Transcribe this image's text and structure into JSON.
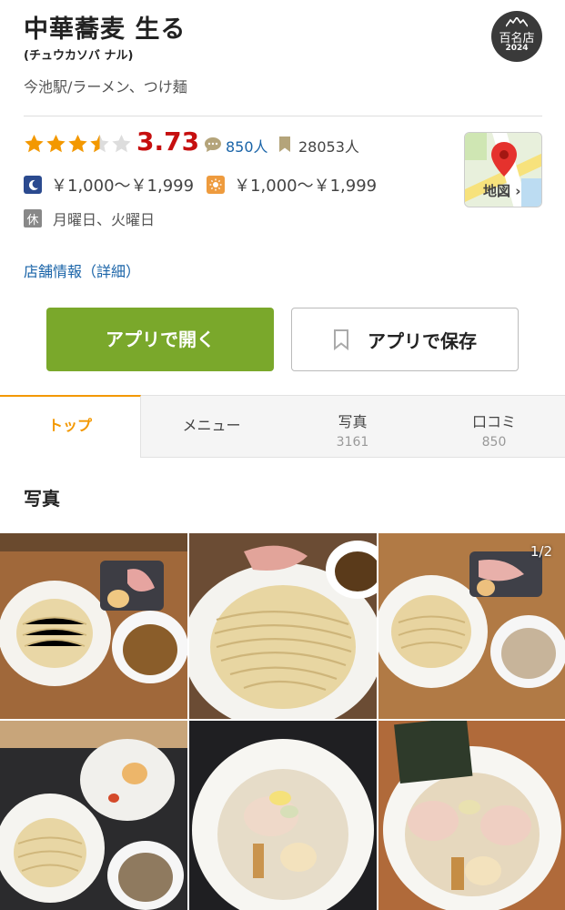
{
  "shop": {
    "name": "中華蕎麦 生る",
    "kana": "(チュウカソバ ナル)",
    "genre": "今池駅/ラーメン、つけ麺"
  },
  "badge": {
    "label": "百名店",
    "year": "2024"
  },
  "rating": {
    "stars": 3.5,
    "score": "3.73",
    "reviews": "850人",
    "saves": "28053人"
  },
  "map": {
    "label": "地図 ›"
  },
  "price": {
    "dinner": "￥1,000～￥1,999",
    "lunch": "￥1,000～￥1,999"
  },
  "holiday": {
    "icon": "休",
    "days": "月曜日、火曜日"
  },
  "store_info_link": "店舗情報（詳細）",
  "buttons": {
    "open_app": "アプリで開く",
    "save_app": "アプリで保存"
  },
  "tabs": [
    {
      "label": "トップ",
      "count": ""
    },
    {
      "label": "メニュー",
      "count": ""
    },
    {
      "label": "写真",
      "count": "3161"
    },
    {
      "label": "口コミ",
      "count": "850"
    }
  ],
  "photos": {
    "section_title": "写真",
    "counter": "1/2"
  },
  "colors": {
    "accent_orange": "#f39800",
    "rating_red": "#c60f0f",
    "link_blue": "#1a64a8",
    "button_green": "#7aa82b"
  },
  "icons": [
    "bookmark-icon",
    "review-bubble-icon",
    "star-icon",
    "map-pin-icon",
    "moon-icon",
    "sun-icon"
  ]
}
